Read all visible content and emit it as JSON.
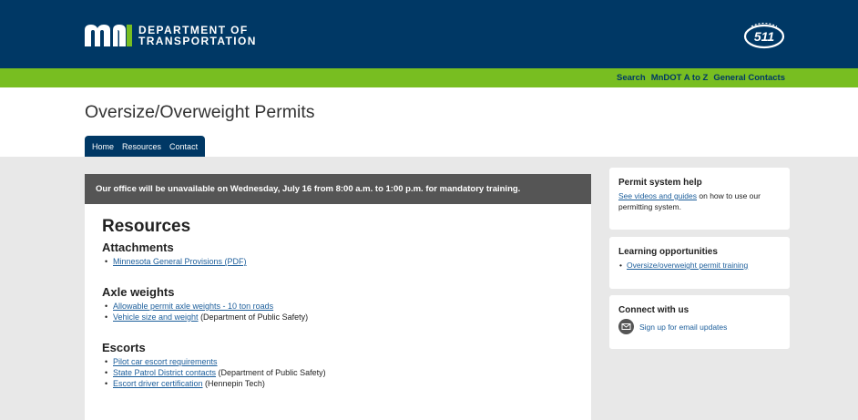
{
  "header": {
    "logo_line1": "DEPARTMENT OF",
    "logo_line2": "TRANSPORTATION",
    "badge_text": "511",
    "brand_color": "#003865",
    "accent_color": "#78be21"
  },
  "util_links": [
    "Search",
    "MnDOT A to Z",
    "General Contacts"
  ],
  "page_title": "Oversize/Overweight Permits",
  "tabs": [
    "Home",
    "Resources",
    "Contact"
  ],
  "notice": "Our office will be unavailable on Wednesday, July 16 from 8:00 a.m. to 1:00 p.m. for mandatory training.",
  "main": {
    "heading": "Resources",
    "sections": [
      {
        "title": "Attachments",
        "items": [
          {
            "link": "Minnesota General Provisions (PDF)",
            "suffix": ""
          }
        ]
      },
      {
        "title": "Axle weights",
        "items": [
          {
            "link": "Allowable permit axle weights - 10 ton roads",
            "suffix": ""
          },
          {
            "link": "Vehicle size and weight",
            "suffix": " (Department of Public Safety)"
          }
        ]
      },
      {
        "title": "Escorts",
        "items": [
          {
            "link": "Pilot car escort requirements",
            "suffix": ""
          },
          {
            "link": "State Patrol District contacts",
            "suffix": " (Department of Public Safety)"
          },
          {
            "link": "Escort driver certification",
            "suffix": " (Hennepin Tech)"
          }
        ]
      }
    ]
  },
  "sidebar": {
    "help": {
      "title": "Permit system help",
      "link": "See videos and guides",
      "text": " on how to use our permitting system."
    },
    "learning": {
      "title": "Learning opportunities",
      "items": [
        "Oversize/overweight permit training"
      ]
    },
    "connect": {
      "title": "Connect with us",
      "link": "Sign up for email updates",
      "icon": "mail-icon"
    }
  }
}
